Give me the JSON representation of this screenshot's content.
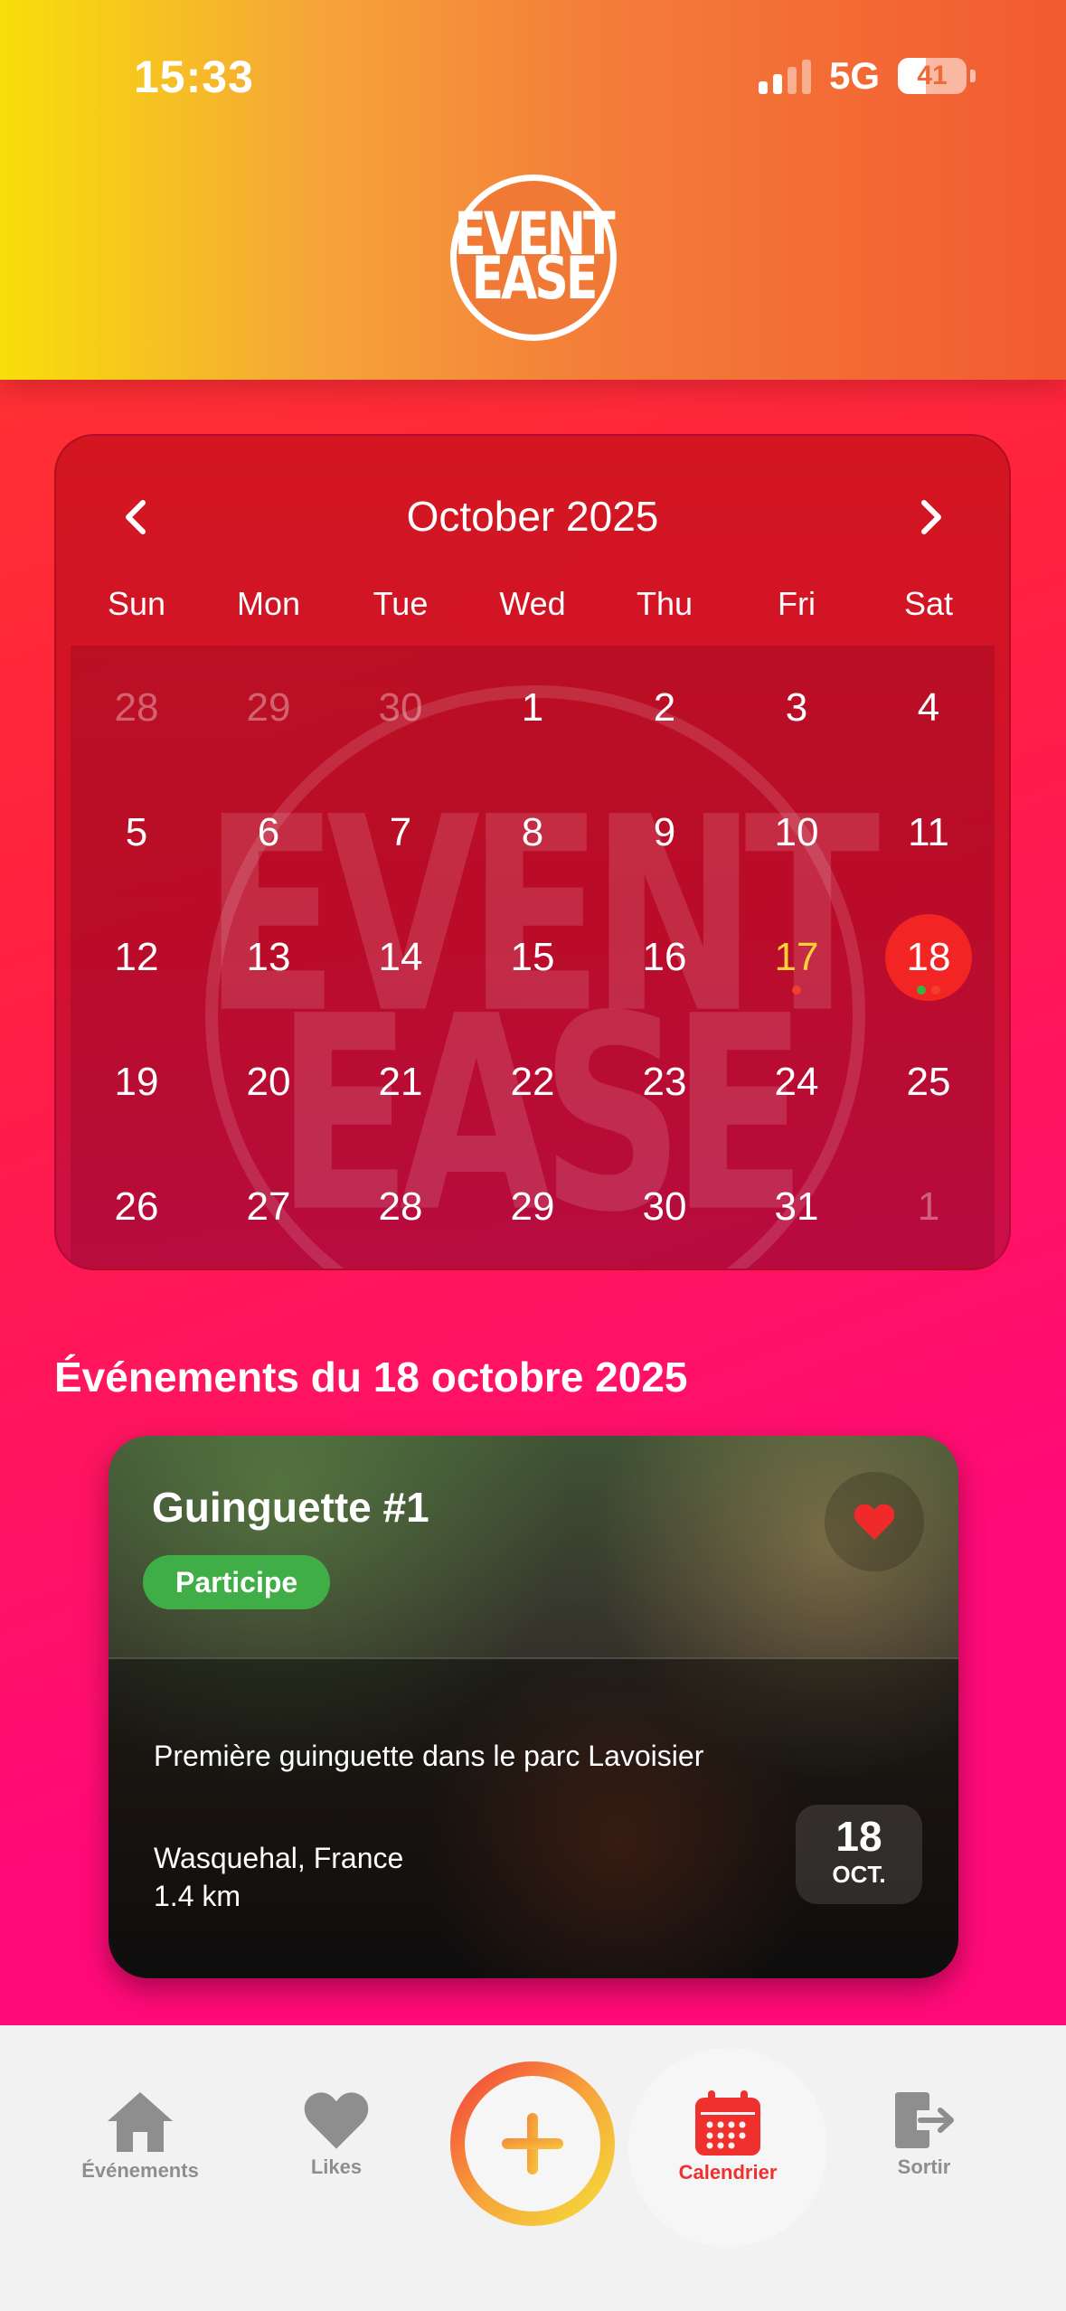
{
  "status_bar": {
    "time": "15:33",
    "network": "5G",
    "battery": "41",
    "battery_level": 0.41
  },
  "logo": {
    "line1": "EVENT",
    "line2": "EASE"
  },
  "calendar": {
    "month_title": "October 2025",
    "weekdays": [
      "Sun",
      "Mon",
      "Tue",
      "Wed",
      "Thu",
      "Fri",
      "Sat"
    ],
    "days": [
      [
        "28",
        "29",
        "30",
        "1",
        "2",
        "3",
        "4"
      ],
      [
        "5",
        "6",
        "7",
        "8",
        "9",
        "10",
        "11"
      ],
      [
        "12",
        "13",
        "14",
        "15",
        "16",
        "17",
        "18"
      ],
      [
        "19",
        "20",
        "21",
        "22",
        "23",
        "24",
        "25"
      ],
      [
        "26",
        "27",
        "28",
        "29",
        "30",
        "31",
        "1"
      ]
    ],
    "today": "17",
    "selected": "18",
    "colors": {
      "today": "#ffd23a",
      "selected": "#f22424",
      "dot_red": "#f0402c",
      "dot_green": "#3fae46"
    }
  },
  "events_heading": "Événements du 18 octobre 2025",
  "event_card": {
    "title": "Guinguette #1",
    "badge": "Participe",
    "description": "Première guinguette dans le parc Lavoisier",
    "location": "Wasquehal, France",
    "distance": "1.4 km",
    "date_day": "18",
    "date_month": "OCT.",
    "liked": true
  },
  "tabbar": {
    "events_label": "Événements",
    "likes_label": "Likes",
    "calendar_label": "Calendrier",
    "exit_label": "Sortir",
    "active": "calendar",
    "colors": {
      "active": "#f0302c",
      "inactive": "#8e8e8e"
    }
  }
}
